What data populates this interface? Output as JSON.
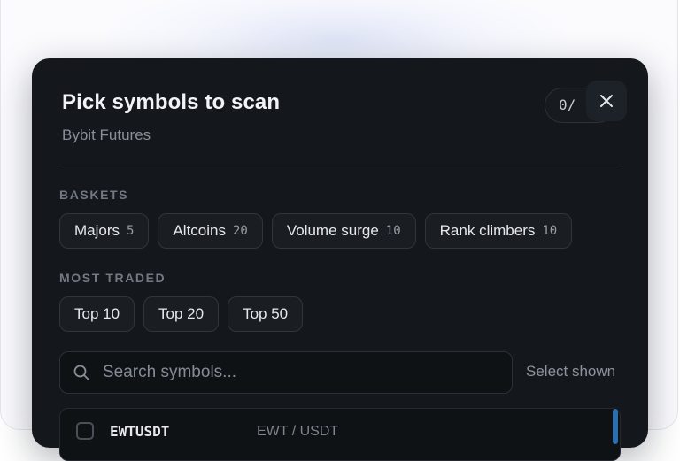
{
  "modal": {
    "title": "Pick symbols to scan",
    "subtitle": "Bybit Futures",
    "counter": "0/",
    "close_icon": "close-icon"
  },
  "baskets": {
    "label": "BASKETS",
    "items": [
      {
        "label": "Majors",
        "count": "5"
      },
      {
        "label": "Altcoins",
        "count": "20"
      },
      {
        "label": "Volume surge",
        "count": "10"
      },
      {
        "label": "Rank climbers",
        "count": "10"
      }
    ]
  },
  "most_traded": {
    "label": "MOST TRADED",
    "items": [
      {
        "label": "Top 10"
      },
      {
        "label": "Top 20"
      },
      {
        "label": "Top 50"
      }
    ]
  },
  "search": {
    "placeholder": "Search symbols...",
    "icon": "search-icon",
    "select_shown": "Select shown"
  },
  "symbols": [
    {
      "symbol": "EWTUSDT",
      "pair": "EWT / USDT"
    }
  ],
  "colors": {
    "modal_bg": "#14171b",
    "accent": "#2b6fb0"
  }
}
